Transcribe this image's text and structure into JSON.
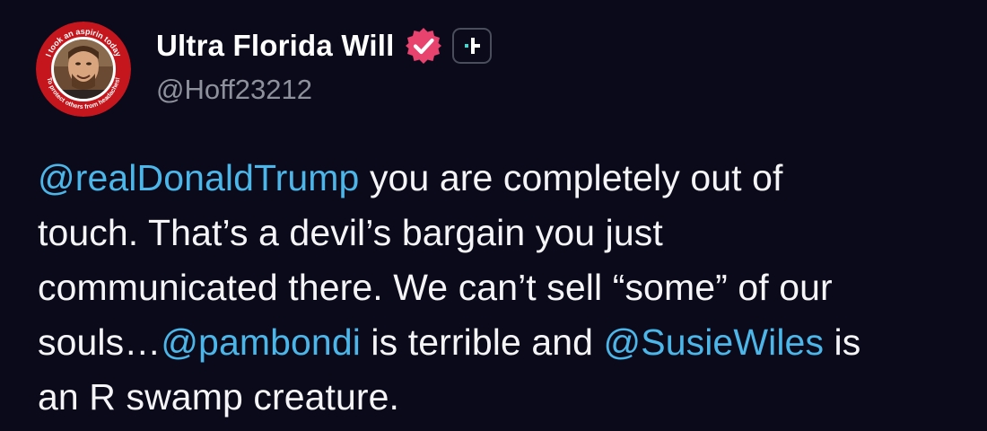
{
  "author": {
    "display_name": "Ultra Florida Will",
    "handle": "@Hoff23212",
    "avatar_text_top": "I took an aspirin today",
    "avatar_text_bottom": "To protect others from headaches!"
  },
  "tweet": {
    "line1": {
      "mention": "@realDonaldTrump",
      "text": " you are completely out of"
    },
    "line2": {
      "text": "touch. That’s a devil’s bargain you just"
    },
    "line3": {
      "text": "communicated there. We can’t sell “some” of our"
    },
    "line4": {
      "text_a": "souls…",
      "mention_a": "@pambondi",
      "text_b": " is terrible and ",
      "mention_b": "@SusieWiles",
      "text_c": " is"
    },
    "line5": {
      "text": "an R swamp creature."
    }
  },
  "icons": {
    "verified": "verified-badge-icon",
    "subscribe": "subscribe-plus-icon"
  },
  "colors": {
    "background": "#0b0a1a",
    "mention": "#4cb6e8",
    "verified": "#e8426e",
    "subscribe_accent": "#3fd9d0"
  }
}
